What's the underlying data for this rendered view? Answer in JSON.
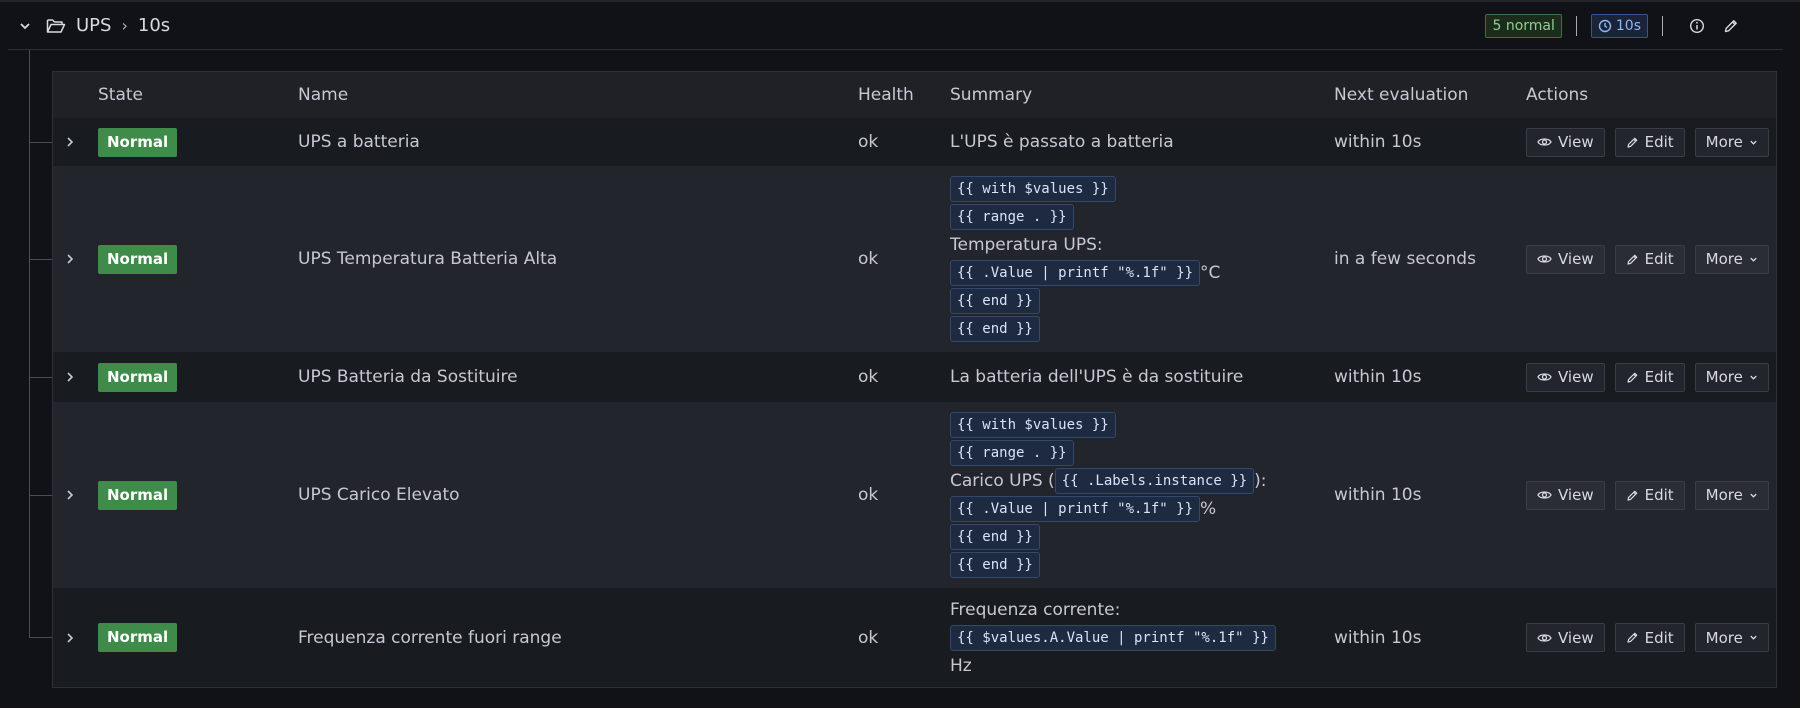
{
  "group": {
    "folder_name": "UPS",
    "separator": "›",
    "interval": "10s",
    "normal_count_label": "5 normal",
    "interval_badge": "10s"
  },
  "table": {
    "columns": {
      "state": "State",
      "name": "Name",
      "health": "Health",
      "summary": "Summary",
      "next_evaluation": "Next evaluation",
      "actions": "Actions"
    },
    "buttons": {
      "view": "View",
      "edit": "Edit",
      "more": "More"
    },
    "rows": [
      {
        "state": "Normal",
        "name": "UPS a batteria",
        "health": "ok",
        "summary": [
          [
            {
              "t": "text",
              "v": "L'UPS è passato a batteria"
            }
          ]
        ],
        "next_evaluation": "within 10s"
      },
      {
        "state": "Normal",
        "name": "UPS Temperatura Batteria Alta",
        "health": "ok",
        "summary": [
          [
            {
              "t": "code",
              "v": "{{ with $values }}"
            }
          ],
          [
            {
              "t": "code",
              "v": "{{ range . }}"
            }
          ],
          [
            {
              "t": "text",
              "v": "Temperatura UPS:"
            }
          ],
          [
            {
              "t": "code",
              "v": "{{ .Value | printf \"%.1f\" }}"
            },
            {
              "t": "text",
              "v": "°C"
            }
          ],
          [
            {
              "t": "code",
              "v": "{{ end }}"
            }
          ],
          [
            {
              "t": "code",
              "v": "{{ end }}"
            }
          ]
        ],
        "next_evaluation": "in a few seconds"
      },
      {
        "state": "Normal",
        "name": "UPS Batteria da Sostituire",
        "health": "ok",
        "summary": [
          [
            {
              "t": "text",
              "v": "La batteria dell'UPS è da sostituire"
            }
          ]
        ],
        "next_evaluation": "within 10s"
      },
      {
        "state": "Normal",
        "name": "UPS Carico Elevato",
        "health": "ok",
        "summary": [
          [
            {
              "t": "code",
              "v": "{{ with $values }}"
            }
          ],
          [
            {
              "t": "code",
              "v": "{{ range . }}"
            }
          ],
          [
            {
              "t": "text",
              "v": "Carico UPS ("
            },
            {
              "t": "code",
              "v": "{{ .Labels.instance }}"
            },
            {
              "t": "text",
              "v": "):"
            }
          ],
          [
            {
              "t": "code",
              "v": "{{ .Value | printf \"%.1f\" }}"
            },
            {
              "t": "text",
              "v": "%"
            }
          ],
          [
            {
              "t": "code",
              "v": "{{ end }}"
            }
          ],
          [
            {
              "t": "code",
              "v": "{{ end }}"
            }
          ]
        ],
        "next_evaluation": "within 10s"
      },
      {
        "state": "Normal",
        "name": "Frequenza corrente fuori range",
        "health": "ok",
        "summary": [
          [
            {
              "t": "text",
              "v": "Frequenza corrente:"
            }
          ],
          [
            {
              "t": "code",
              "v": "{{ $values.A.Value | printf \"%.1f\" }}"
            }
          ],
          [
            {
              "t": "text",
              "v": "Hz"
            }
          ]
        ],
        "next_evaluation": "within 10s"
      }
    ]
  },
  "colors": {
    "state_normal": "#3e8b4a",
    "badge_normal_text": "#8ecf91",
    "interval_badge_text": "#8db7f5",
    "background": "#111217"
  }
}
